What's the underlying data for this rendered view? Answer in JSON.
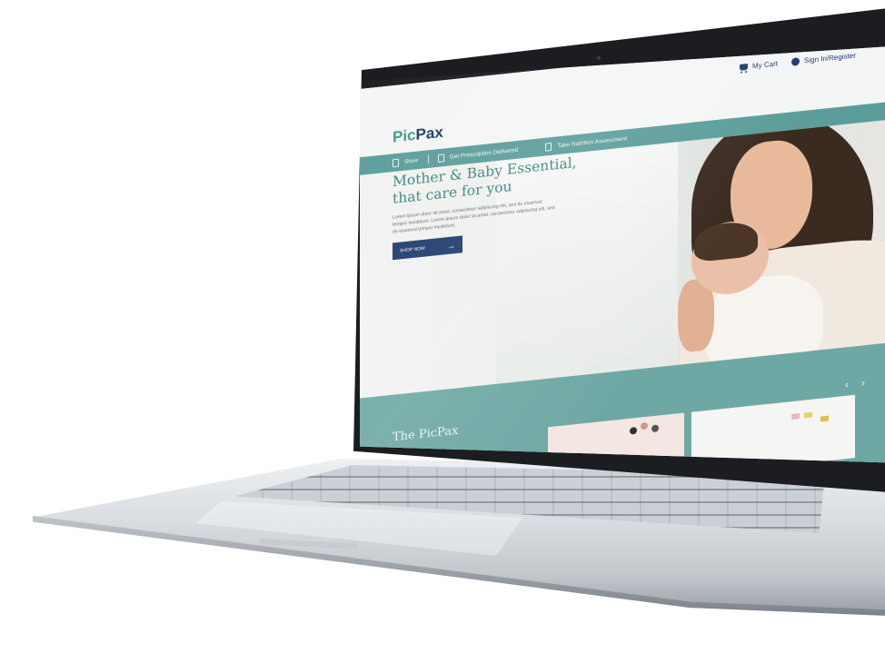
{
  "header": {
    "cart_label": "My Cart",
    "signin_label": "Sign In/Register"
  },
  "logo": {
    "part1": "Pic",
    "part2": "Pax"
  },
  "nav": {
    "items": [
      "Store",
      "Get Prescription Delivered",
      "Take Nutrition Assessment"
    ]
  },
  "hero": {
    "title_line1": "Mother & Baby Essential,",
    "title_line2": "that care for you",
    "body": "Lorem ipsum dolor sit amet, consectetur adipiscing elit, sed do eiusmod tempor incididunt. Lorem ipsum dolor sit amet, consectetur adipiscing elit, sed do eiusmod tempor incididunt.",
    "button_label": "SHOP NOW"
  },
  "section": {
    "title": "The PicPax"
  },
  "icons": {
    "cart": "cart-icon",
    "user": "user-icon",
    "arrow": "arrow-right-icon",
    "prev": "chevron-left-icon",
    "next": "chevron-right-icon"
  },
  "colors": {
    "teal": "#5b9d9a",
    "navy": "#1e3a6e",
    "title_teal": "#3b857e",
    "section_bg": "#6ea8a4"
  }
}
